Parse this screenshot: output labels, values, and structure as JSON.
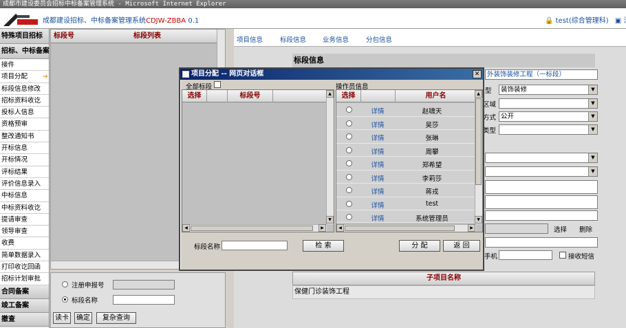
{
  "window": {
    "title": "成都市建设委员会招标中标备案管理系统 - Microsoft Internet Explorer"
  },
  "header": {
    "app_name": "成都建设招标、中标备案管理系统",
    "app_code": "CDJW-ZBBA",
    "version": "0.1",
    "user": "test(综合管理科)",
    "logout": "注销"
  },
  "sidebar": {
    "section1": "特殊项目招标",
    "section2": "招标、中标备案",
    "items": [
      "接件",
      "项目分配",
      "标段信息修改",
      "招标资料收讫",
      "投标人信息",
      "资格预审",
      "整改通知书",
      "开标信息",
      "开标情况",
      "评标结果",
      "评价信息录入",
      "中标信息",
      "中标资料收讫",
      "提请审查",
      "领导审查",
      "收费",
      "简单数据录入",
      "打印收讫回函",
      "招标计划审批"
    ],
    "section3": "合同备案",
    "section4": "竣工备案",
    "section5": "撤查"
  },
  "list_panel": {
    "col_section_no": "标段号",
    "col_section_list": "标段列表"
  },
  "search_panel": {
    "opt_register": "注册申报号",
    "opt_section_name": "标段名称",
    "btn_read_card": "读卡",
    "btn_ok": "确定",
    "btn_complex": "复杂查询"
  },
  "tabs": [
    "项目信息",
    "标段信息",
    "业务信息",
    "分包信息"
  ],
  "main": {
    "section_title": "标段信息",
    "project_name": "外装饰装修工程（一标段）",
    "label_type_suffix": "型",
    "label_region_suffix": "区域",
    "label_method_suffix": "方式",
    "label_type2_suffix": "类型",
    "type_value": "装饰装修",
    "method_value": "公开",
    "btn_select": "选择",
    "btn_delete": "删除",
    "label_mobile_suffix": "手机",
    "chk_sms": "接收短信",
    "subproject_header": "子项目名称",
    "subproject_row": "保健门诊装饰工程"
  },
  "dialog": {
    "title": "项目分配 -- 网页对话框",
    "all_sections": "全部标段",
    "left_col_select": "选择",
    "left_col_section_no": "标段号",
    "operators_label": "操作员信息",
    "right_col_select": "选择",
    "right_col_username": "用户名",
    "detail_label": "详情",
    "users": [
      "赵啸天",
      "吴莎",
      "张琳",
      "周攀",
      "郑希望",
      "李莉莎",
      "蒋戎",
      "test",
      "系统管理员"
    ],
    "section_name_label": "标段名称",
    "btn_search": "检 索",
    "btn_assign": "分 配",
    "btn_back": "返 回"
  }
}
